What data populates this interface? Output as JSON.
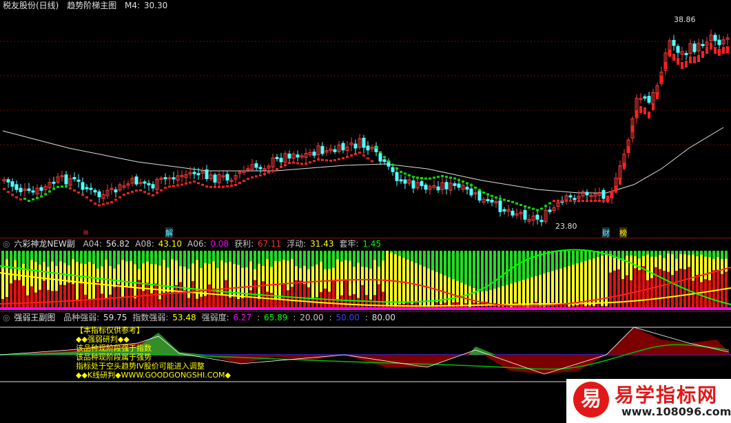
{
  "main": {
    "stock_name": "税友股份(日线)",
    "indicator": "趋势阶梯主图",
    "m4_label": "M4:",
    "m4_value": "30.30",
    "high_label": "38.86",
    "low_label": "23.80",
    "markers": {
      "m1": "≋",
      "m2": "解",
      "m3": "财",
      "m4": "榜"
    },
    "colors": {
      "up": "#ff3c3c",
      "down": "#54ffff",
      "support": "#ff2020",
      "resist": "#00e000",
      "ma": "#e0e0e0"
    }
  },
  "panel1": {
    "name": "六彩神龙NEW副",
    "fields": [
      {
        "key": "A04:",
        "value": "56.82",
        "color": "#e0e0e0"
      },
      {
        "key": "A08:",
        "value": "43.10",
        "color": "#ffff00"
      },
      {
        "key": "A06:",
        "value": "0.08",
        "color": "#ff00ff"
      },
      {
        "key": "获利:",
        "value": "67.11",
        "color": "#ff3030"
      },
      {
        "key": "浮动:",
        "value": "31.43",
        "color": "#ffff00"
      },
      {
        "key": "套牢:",
        "value": "1.45",
        "color": "#00ff00"
      }
    ]
  },
  "panel2": {
    "name": "强弱王副图",
    "fields": [
      {
        "key": "品种强弱:",
        "value": "59.75",
        "color": "#e0e0e0"
      },
      {
        "key": "指数强弱:",
        "value": "53.48",
        "color": "#ffff00"
      },
      {
        "key": "强弱度:",
        "value": "6.27",
        "color": "#ff00ff"
      },
      {
        "key": ":",
        "value": "65.89",
        "color": "#00ff00"
      },
      {
        "key": ":",
        "value": "20.00",
        "color": "#c8c8c8"
      },
      {
        "key": ":",
        "value": "50.00",
        "color": "#4040ff"
      },
      {
        "key": ":",
        "value": "80.00",
        "color": "#e0e0e0"
      }
    ],
    "info_lines": [
      "【本指标仅供参考】",
      "◆◆强弱研判◆◆",
      "该品种现阶段强于指数",
      "该品种现阶段属于强势",
      "指标处于空头趋势IV股价可能进入调整",
      "◆◆K线研判◆WWW.GOODGONGSHI.COM◆"
    ]
  },
  "watermark": {
    "icon_char": "易",
    "title": "易学指标网",
    "url": "www.108096.com"
  }
}
